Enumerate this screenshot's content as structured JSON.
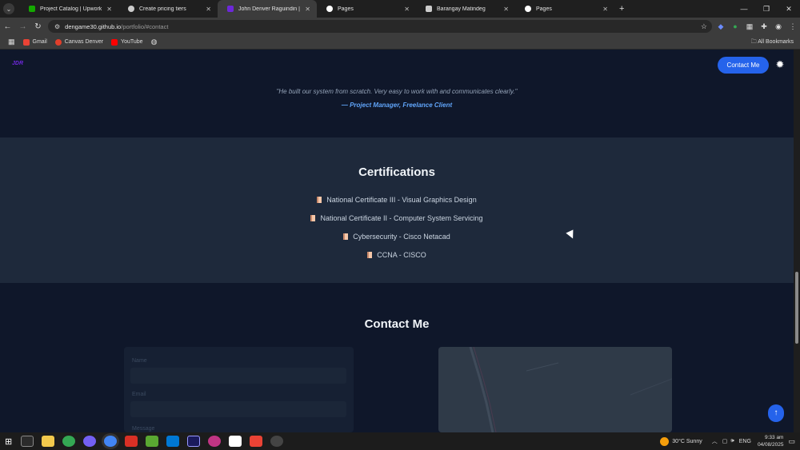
{
  "browser": {
    "tabs": [
      {
        "title": "Project Catalog | Upwork",
        "favicon_color": "#14a800",
        "active": false
      },
      {
        "title": "Create pricing tiers",
        "favicon_color": "#cccccc",
        "active": false
      },
      {
        "title": "John Denver Raguindin | Portfo",
        "favicon_color": "#6d28d9",
        "active": true
      },
      {
        "title": "Pages",
        "favicon_color": "#ffffff",
        "active": false
      },
      {
        "title": "Barangay Matindeg",
        "favicon_color": "#cccccc",
        "active": false
      },
      {
        "title": "Pages",
        "favicon_color": "#ffffff",
        "active": false
      }
    ],
    "url_host": "dengame30.github.io",
    "url_path": "/portfolio/#contact",
    "bookmarks": [
      {
        "label": "Gmail",
        "icon_color": "#ea4335"
      },
      {
        "label": "Canvas Denver",
        "icon_color": "#e13f2b"
      },
      {
        "label": "YouTube",
        "icon_color": "#ff0000"
      }
    ],
    "all_bookmarks_label": "All Bookmarks"
  },
  "page": {
    "logo": "JDR",
    "contact_button": "Contact Me",
    "testimonial": {
      "quote": "\"He built our system from scratch. Very easy to work with and communicates clearly.\"",
      "author": "— Project Manager, Freelance Client"
    },
    "certifications": {
      "title": "Certifications",
      "items": [
        "National Certificate III - Visual Graphics Design",
        "National Certificate II - Computer System Servicing",
        "Cybersecurity - Cisco Netacad",
        "CCNA - CISCO"
      ]
    },
    "contact": {
      "title": "Contact Me",
      "name_label": "Name",
      "email_label": "Email",
      "message_label": "Message"
    },
    "back_to_top": "↑"
  },
  "taskbar": {
    "weather": "30°C  Sunny",
    "language": "ENG",
    "time": "9:33 am",
    "date": "04/08/2025"
  },
  "colors": {
    "accent": "#2563eb",
    "link": "#60a5fa",
    "bg_dark": "#0f172a",
    "bg_section": "#1e293b"
  }
}
